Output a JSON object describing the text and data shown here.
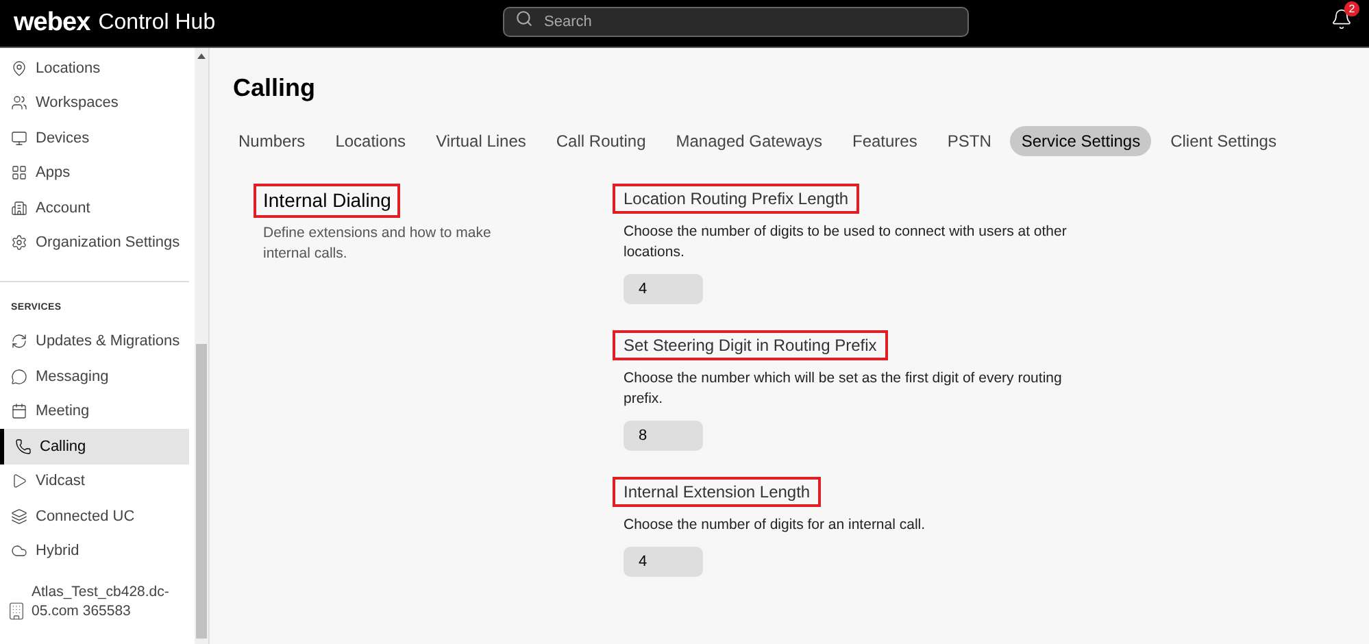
{
  "header": {
    "brand": "webex",
    "product": "Control Hub",
    "search": {
      "placeholder": "Search"
    },
    "notifications": {
      "count": "2"
    }
  },
  "sidebar": {
    "items": [
      {
        "label": "Locations",
        "selected": false
      },
      {
        "label": "Workspaces",
        "selected": false
      },
      {
        "label": "Devices",
        "selected": false
      },
      {
        "label": "Apps",
        "selected": false
      },
      {
        "label": "Account",
        "selected": false
      },
      {
        "label": "Organization Settings",
        "selected": false
      }
    ],
    "section_title": "SERVICES",
    "services": [
      {
        "label": "Updates & Migrations",
        "selected": false
      },
      {
        "label": "Messaging",
        "selected": false
      },
      {
        "label": "Meeting",
        "selected": false
      },
      {
        "label": "Calling",
        "selected": true
      },
      {
        "label": "Vidcast",
        "selected": false
      },
      {
        "label": "Connected UC",
        "selected": false
      },
      {
        "label": "Hybrid",
        "selected": false
      }
    ],
    "organization": "Atlas_Test_cb428.dc-05.com 365583"
  },
  "page": {
    "title": "Calling",
    "tabs": [
      {
        "label": "Numbers",
        "selected": false
      },
      {
        "label": "Locations",
        "selected": false
      },
      {
        "label": "Virtual Lines",
        "selected": false
      },
      {
        "label": "Call Routing",
        "selected": false
      },
      {
        "label": "Managed Gateways",
        "selected": false
      },
      {
        "label": "Features",
        "selected": false
      },
      {
        "label": "PSTN",
        "selected": false
      },
      {
        "label": "Service Settings",
        "selected": true
      },
      {
        "label": "Client Settings",
        "selected": false
      }
    ],
    "section": {
      "title": "Internal Dialing",
      "highlighted": true,
      "description": "Define extensions and how to make internal calls."
    },
    "settings": [
      {
        "title": "Location Routing Prefix Length",
        "highlighted": true,
        "description": "Choose the number of digits to be used to connect with users at other locations.",
        "value": "4"
      },
      {
        "title": "Set Steering Digit in Routing Prefix",
        "highlighted": true,
        "description": "Choose the number which will be set as the first digit of every routing prefix.",
        "value": "8"
      },
      {
        "title": "Internal Extension Length",
        "highlighted": true,
        "description": "Choose the number of digits for an internal call.",
        "value": "4"
      }
    ]
  }
}
